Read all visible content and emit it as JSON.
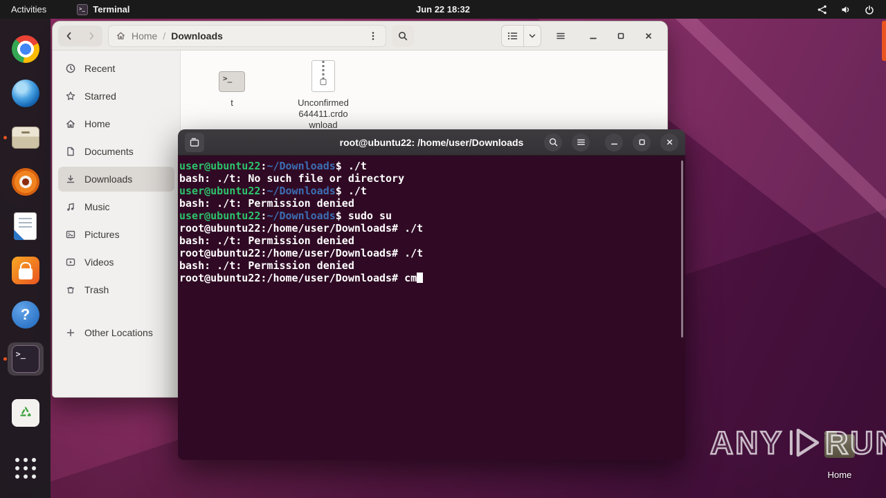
{
  "colors": {
    "accent": "#e95420"
  },
  "glyphs": {
    "terminal_prompt": ">_",
    "help": "?"
  },
  "topbar": {
    "activities": "Activities",
    "app_name": "Terminal",
    "clock": "Jun 22 18:32"
  },
  "dock": {
    "items": [
      "chrome",
      "thunderbird",
      "files",
      "rhythmbox",
      "libreoffice-writer",
      "ubuntu-software",
      "help",
      "terminal",
      "trash",
      "app-grid"
    ],
    "running": [
      "files",
      "terminal"
    ],
    "focused": "terminal"
  },
  "files_window": {
    "breadcrumb": {
      "root": "Home",
      "separator": "/",
      "current": "Downloads"
    },
    "sidebar": [
      {
        "label": "Recent"
      },
      {
        "label": "Starred"
      },
      {
        "label": "Home"
      },
      {
        "label": "Documents"
      },
      {
        "label": "Downloads",
        "selected": true
      },
      {
        "label": "Music"
      },
      {
        "label": "Pictures"
      },
      {
        "label": "Videos"
      },
      {
        "label": "Trash"
      }
    ],
    "other_locations_label": "Other Locations",
    "files": [
      {
        "name": "t",
        "type": "executable"
      },
      {
        "name": "Unconfirmed 644411.crdownload",
        "type": "partial-download"
      }
    ]
  },
  "terminal": {
    "title": "root@ubuntu22: /home/user/Downloads",
    "colors": {
      "background": "#300a24",
      "green": "#2cc36b",
      "blue": "#3c6eb4",
      "white": "#ffffff"
    },
    "lines": [
      [
        {
          "c": "green",
          "t": "user@ubuntu22"
        },
        {
          "c": "white",
          "t": ":"
        },
        {
          "c": "blue",
          "t": "~/Downloads"
        },
        {
          "c": "white",
          "t": "$ ./t"
        }
      ],
      [
        {
          "c": "white",
          "t": "bash: ./t: No such file or directory"
        }
      ],
      [
        {
          "c": "green",
          "t": "user@ubuntu22"
        },
        {
          "c": "white",
          "t": ":"
        },
        {
          "c": "blue",
          "t": "~/Downloads"
        },
        {
          "c": "white",
          "t": "$ ./t"
        }
      ],
      [
        {
          "c": "white",
          "t": "bash: ./t: Permission denied"
        }
      ],
      [
        {
          "c": "green",
          "t": "user@ubuntu22"
        },
        {
          "c": "white",
          "t": ":"
        },
        {
          "c": "blue",
          "t": "~/Downloads"
        },
        {
          "c": "white",
          "t": "$ sudo su"
        }
      ],
      [
        {
          "c": "white",
          "t": "root@ubuntu22:/home/user/Downloads# ./t"
        }
      ],
      [
        {
          "c": "white",
          "t": "bash: ./t: Permission denied"
        }
      ],
      [
        {
          "c": "white",
          "t": "root@ubuntu22:/home/user/Downloads# ./t"
        }
      ],
      [
        {
          "c": "white",
          "t": "bash: ./t: Permission denied"
        }
      ],
      [
        {
          "c": "white",
          "t": "root@ubuntu22:/home/user/Downloads# cm"
        },
        {
          "c": "cursor",
          "t": " "
        }
      ]
    ]
  },
  "desktop": {
    "home_label": "Home",
    "watermark_left": "ANY",
    "watermark_right": "RUN"
  }
}
